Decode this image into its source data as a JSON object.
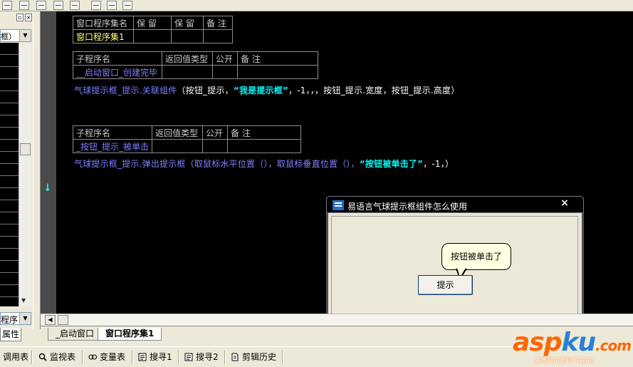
{
  "left_panel": {
    "combo_text": "框）",
    "combo2_text": "程序",
    "tab_label": "属性"
  },
  "editor": {
    "table1": {
      "headers": [
        "窗口程序集名",
        "保 留",
        "保 留",
        "备 注"
      ],
      "row": [
        "窗口程序集1",
        "",
        "",
        ""
      ]
    },
    "table2": {
      "headers": [
        "子程序名",
        "返回值类型",
        "公开",
        "备 注"
      ],
      "row": [
        "__启动窗口_创建完毕",
        "",
        "",
        ""
      ]
    },
    "code_line1": {
      "obj": "气球提示框_提示.关联组件",
      "args_a": "（按钮_提示，",
      "str": "“我是提示框”",
      "args_b": "，-1，，，按钮_提示.宽度，按钮_提示.高度）"
    },
    "table3": {
      "headers": [
        "子程序名",
        "返回值类型",
        "公开",
        "备 注"
      ],
      "row": [
        "_按钮_提示_被单击",
        "",
        "",
        ""
      ]
    },
    "code_line2": {
      "obj": "气球提示框_提示.弹出提示框",
      "args_a": "（取鼠标水平位置（），取鼠标垂直位置（），",
      "str": "“按钮被单击了”",
      "args_b": "，-1，）"
    },
    "cursor_glyph": "↓"
  },
  "popup": {
    "title": "易语言气球提示框组件怎么使用",
    "close_glyph": "×",
    "balloon_text": "按钮被单击了",
    "button_label": "提示"
  },
  "tabs": [
    {
      "label": "_启动窗口",
      "active": false
    },
    {
      "label": "窗口程序集1",
      "active": true
    }
  ],
  "bottom_bar": {
    "items": [
      "调用表",
      "监视表",
      "变量表",
      "搜寻1",
      "搜寻2",
      "剪辑历史"
    ]
  },
  "watermark": {
    "text_asp": "asp",
    "text_ku": "ku",
    "text_com": ".com",
    "subtext": "免费网站源码下载站!",
    "colors": {
      "asp": "#ff6600",
      "ku": "#2a7fd4",
      "com": "#ff6600"
    }
  }
}
